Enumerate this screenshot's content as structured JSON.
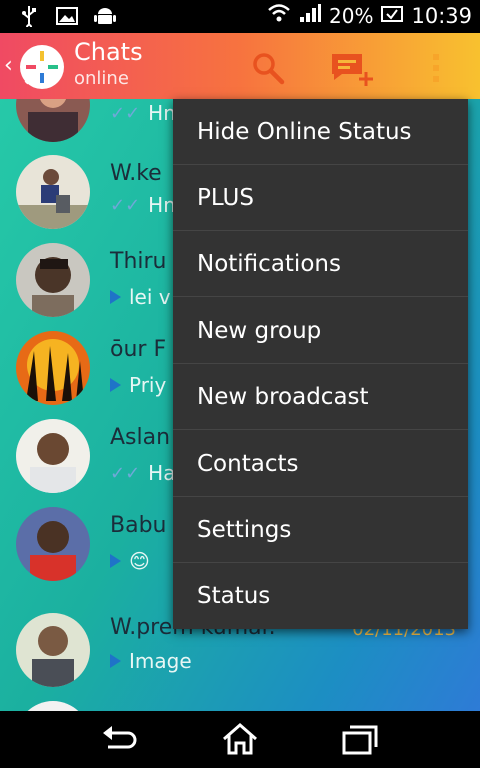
{
  "status_bar": {
    "battery": "20%",
    "time": "10:39"
  },
  "app_bar": {
    "title": "Chats",
    "subtitle": "online"
  },
  "chats": [
    {
      "name": "",
      "message": "Hm",
      "message_type": "read"
    },
    {
      "name": "W.ke",
      "message": "Hm",
      "message_type": "read"
    },
    {
      "name": "Thiru",
      "message": "lei v",
      "message_type": "sent"
    },
    {
      "name": "ōur F",
      "message": "Priy",
      "message_type": "sent"
    },
    {
      "name": "Aslan",
      "message": "Hap",
      "message_type": "read"
    },
    {
      "name": "Babu",
      "message": "😊",
      "message_type": "sent"
    },
    {
      "name": "W.prem kumar.",
      "message": "Image",
      "message_type": "sent",
      "date": "02/11/2013"
    }
  ],
  "menu": {
    "items": [
      "Hide Online Status",
      "PLUS",
      "Notifications",
      "New group",
      "New broadcast",
      "Contacts",
      "Settings",
      "Status"
    ]
  },
  "colors": {
    "appbar_start": "#f04a63",
    "appbar_end": "#f8c12f",
    "accent": "#f7733f",
    "menu_bg": "#333333"
  }
}
